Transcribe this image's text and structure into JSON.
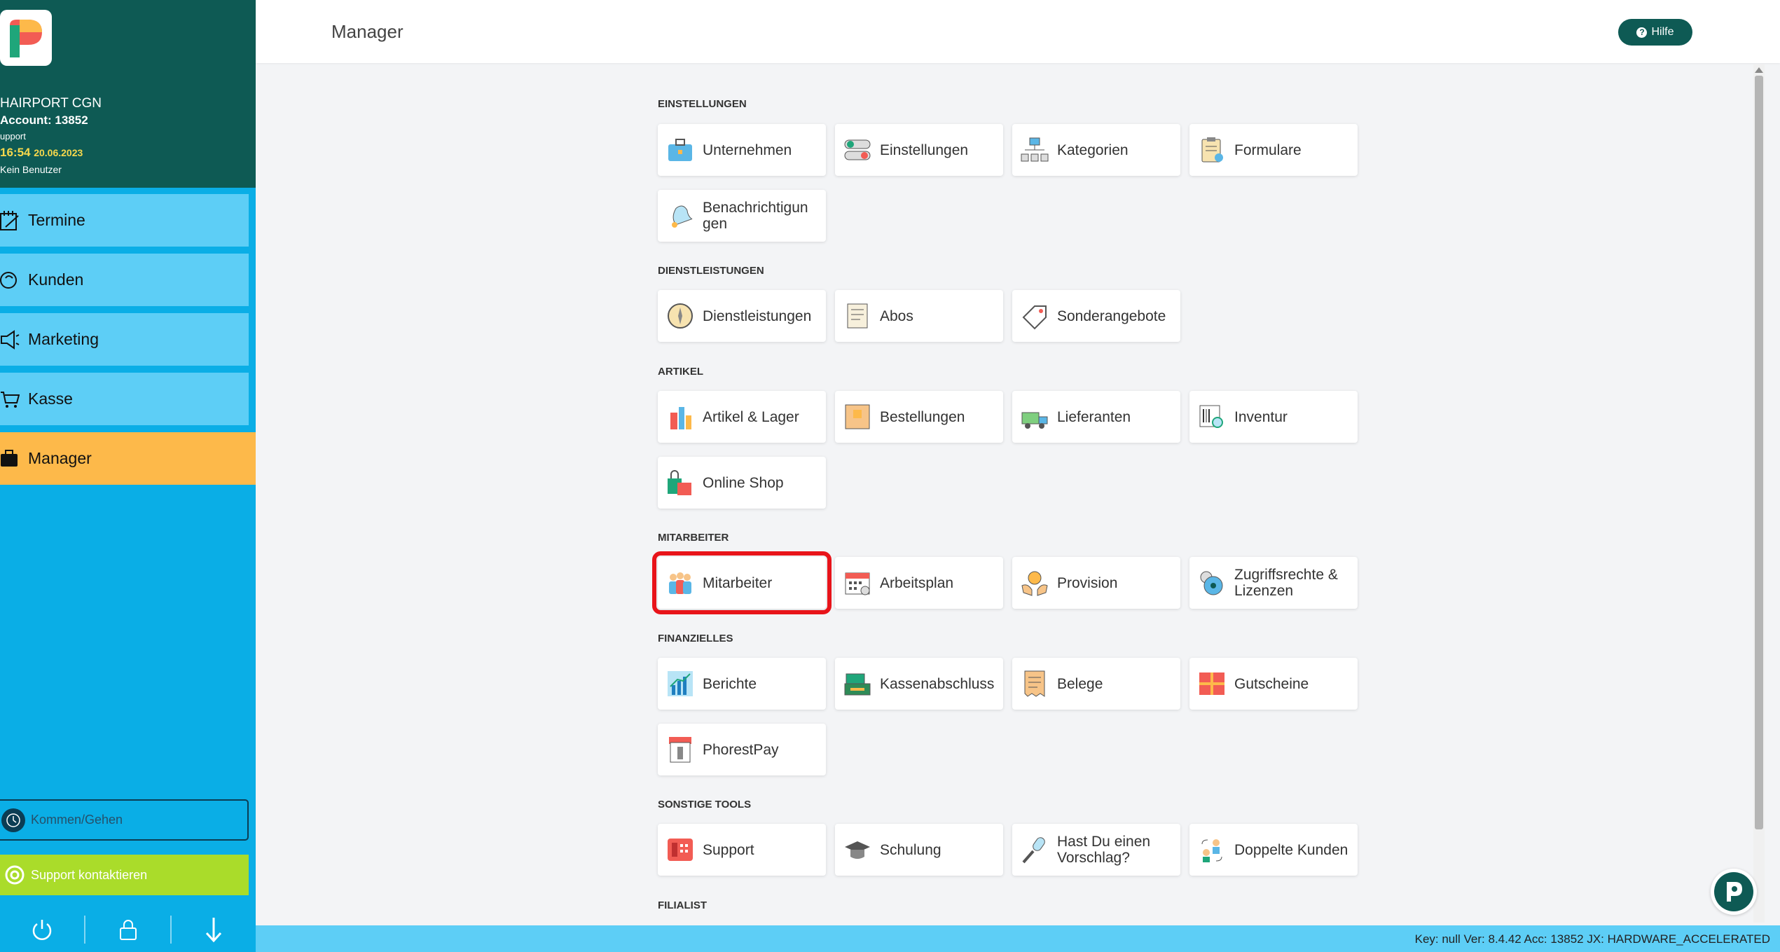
{
  "sidebar": {
    "brand": {
      "name": "HAIRPORT CGN",
      "account": "Account: 13852",
      "role": "upport",
      "time": "16:54",
      "date": "20.06.2023",
      "user": "Kein Benutzer"
    },
    "nav": [
      {
        "label": "Termine",
        "icon": "calendar-edit-icon"
      },
      {
        "label": "Kunden",
        "icon": "customer-head-icon"
      },
      {
        "label": "Marketing",
        "icon": "megaphone-icon"
      },
      {
        "label": "Kasse",
        "icon": "cart-icon"
      },
      {
        "label": "Manager",
        "icon": "briefcase-icon",
        "active": true
      }
    ],
    "kommen_label": "Kommen/Gehen",
    "support_label": "Support kontaktieren",
    "footer_icons": [
      "power-icon",
      "lock-icon",
      "download-arrow-icon"
    ]
  },
  "header": {
    "title": "Manager",
    "help_label": "Hilfe"
  },
  "sections": [
    {
      "title": "EINSTELLUNGEN",
      "tiles": [
        {
          "label": "Unternehmen",
          "icon": "briefcase-icon"
        },
        {
          "label": "Einstellungen",
          "icon": "toggle-switch-icon"
        },
        {
          "label": "Kategorien",
          "icon": "hierarchy-icon"
        },
        {
          "label": "Formulare",
          "icon": "clipboard-icon"
        },
        {
          "label": "Benachrichtigun gen",
          "icon": "bell-icon"
        }
      ]
    },
    {
      "title": "DIENSTLEISTUNGEN",
      "tiles": [
        {
          "label": "Dienstleistungen",
          "icon": "compass-icon"
        },
        {
          "label": "Abos",
          "icon": "list-document-icon"
        },
        {
          "label": "Sonderangebote",
          "icon": "price-tag-icon"
        }
      ]
    },
    {
      "title": "ARTIKEL",
      "tiles": [
        {
          "label": "Artikel & Lager",
          "icon": "products-icon"
        },
        {
          "label": "Bestellungen",
          "icon": "box-icon"
        },
        {
          "label": "Lieferanten",
          "icon": "delivery-truck-icon"
        },
        {
          "label": "Inventur",
          "icon": "barcode-search-icon"
        },
        {
          "label": "Online Shop",
          "icon": "shopping-bag-icon"
        }
      ]
    },
    {
      "title": "MITARBEITER",
      "tiles": [
        {
          "label": "Mitarbeiter",
          "icon": "team-icon",
          "highlight": true
        },
        {
          "label": "Arbeitsplan",
          "icon": "calendar-icon"
        },
        {
          "label": "Provision",
          "icon": "coin-hands-icon"
        },
        {
          "label": "Zugriffsrechte & Lizenzen",
          "icon": "key-lock-icon"
        }
      ]
    },
    {
      "title": "FINANZIELLES",
      "tiles": [
        {
          "label": "Berichte",
          "icon": "bar-chart-icon"
        },
        {
          "label": "Kassenabschluss",
          "icon": "cash-register-icon"
        },
        {
          "label": "Belege",
          "icon": "receipt-icon"
        },
        {
          "label": "Gutscheine",
          "icon": "gift-voucher-icon"
        },
        {
          "label": "PhorestPay",
          "icon": "card-terminal-icon"
        }
      ]
    },
    {
      "title": "SONSTIGE TOOLS",
      "tiles": [
        {
          "label": "Support",
          "icon": "phone-icon"
        },
        {
          "label": "Schulung",
          "icon": "graduation-cap-icon"
        },
        {
          "label": "Hast Du einen Vorschlag?",
          "icon": "microphone-icon"
        },
        {
          "label": "Doppelte Kunden",
          "icon": "duplicate-users-icon"
        }
      ]
    },
    {
      "title": "FILIALIST",
      "tiles": []
    }
  ],
  "status_text": "Key: null Ver: 8.4.42 Acc: 13852  JX: HARDWARE_ACCELERATED",
  "colors": {
    "brand_dark": "#0e5a54",
    "sidebar_blue": "#0aaee6",
    "nav_blue": "#5dcef6",
    "active_orange": "#fdb94a",
    "support_green": "#aadc2a",
    "highlight_red": "#e8141a"
  }
}
